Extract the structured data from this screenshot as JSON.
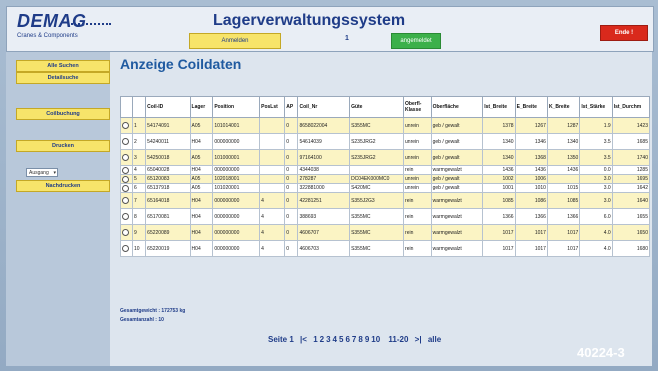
{
  "header": {
    "logo": "DEMAG",
    "logo_sub": "Cranes & Components",
    "title": "Lagerverwaltungssystem",
    "login_button": "Anmelden",
    "number": "1",
    "status": "angemeldet",
    "red_button": "Ende !"
  },
  "sidebar": {
    "buttons": [
      "Alle Suchen",
      "Detailsuche",
      "Coilbuchung",
      "Drucken",
      "Nachdrucken"
    ],
    "select_value": "Ausgang"
  },
  "main": {
    "title": "Anzeige Coildaten",
    "columns": [
      "",
      "",
      "Coil-ID",
      "Lager",
      "Position",
      "PosLst",
      "AP",
      "Coil_Nr",
      "Güte",
      "Oberfl-Klasse",
      "Oberfläche",
      "Ist_Breite",
      "E_Breite",
      "K_Breite",
      "Ist_Stärke",
      "Ist_Durchm"
    ],
    "rows": [
      [
        "1",
        "54174091",
        "A05",
        "101014001",
        "",
        "0",
        "8658022004",
        "S355MC",
        "unrein",
        "geb / gewalt",
        "1378",
        "1267",
        "1287",
        "1.9",
        "1423"
      ],
      [
        "2",
        "54240011",
        "H04",
        "000000000",
        "",
        "0",
        "54614039",
        "S235JRG2",
        "unrein",
        "geb / gewalt",
        "1340",
        "1346",
        "1340",
        "3.5",
        "1685"
      ],
      [
        "3",
        "54250018",
        "A05",
        "101000001",
        "",
        "0",
        "97164100",
        "S235JRG2",
        "unrein",
        "geb / gewalt",
        "1340",
        "1368",
        "1350",
        "3.5",
        "1740"
      ],
      [
        "4",
        "65040028",
        "H04",
        "000000000",
        "",
        "0",
        "4344038",
        "",
        "rein",
        "warmgewalzt",
        "1436",
        "1436",
        "1436",
        "0.0",
        "1285"
      ],
      [
        "5",
        "65120083",
        "A05",
        "102018001",
        "",
        "0",
        "278287",
        "DC04EK000MC0",
        "unrein",
        "geb / gewalt",
        "1002",
        "1006",
        "",
        "3.0",
        "1695"
      ],
      [
        "6",
        "65137918",
        "A05",
        "101020001",
        "",
        "0",
        "322881000",
        "S420MC",
        "unrein",
        "geb / gewalt",
        "1001",
        "1010",
        "1015",
        "3.0",
        "1642"
      ],
      [
        "7",
        "65164018",
        "H04",
        "000000000",
        "4",
        "0",
        "42281251",
        "S355J2G3",
        "rein",
        "warmgewalzt",
        "1085",
        "1086",
        "1085",
        "3.0",
        "1640"
      ],
      [
        "8",
        "65170081",
        "H04",
        "000000000",
        "4",
        "0",
        "388693",
        "S355MC",
        "rein",
        "warmgewalzt",
        "1366",
        "1366",
        "1366",
        "6.0",
        "1655"
      ],
      [
        "9",
        "65220089",
        "H04",
        "000000000",
        "4",
        "0",
        "4606707",
        "S355MC",
        "rein",
        "warmgewalzt",
        "1017",
        "1017",
        "1017",
        "4.0",
        "1650"
      ],
      [
        "10",
        "65220019",
        "H04",
        "000000000",
        "4",
        "0",
        "4606703",
        "S355MC",
        "rein",
        "warmgewalzt",
        "1017",
        "1017",
        "1017",
        "4.0",
        "1680"
      ]
    ],
    "summary_weight": "Gesamtgewicht : 172753 kg",
    "summary_count": "Gesamtanzahl : 10",
    "pager": {
      "label": "Seite 1",
      "first": "|<",
      "pages": [
        "1",
        "2",
        "3",
        "4",
        "5",
        "6",
        "7",
        "8",
        "9",
        "10"
      ],
      "range": "11-20",
      "last": ">|",
      "all": "alle"
    }
  },
  "image_code": "40224-3"
}
